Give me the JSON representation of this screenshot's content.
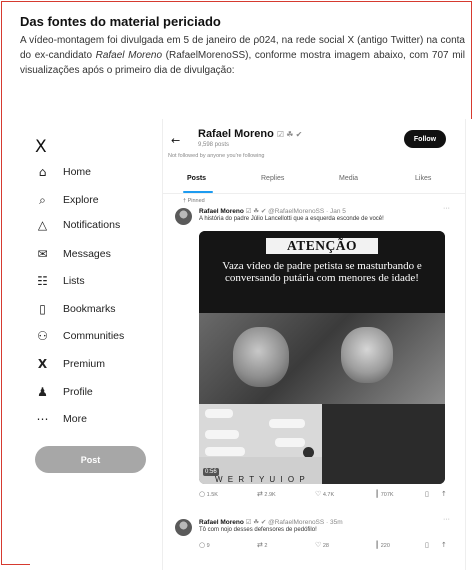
{
  "document": {
    "heading": "Das fontes do material periciado",
    "paragraph": {
      "part1": "A vídeo-montagem foi divulgada em 5 de janeiro de ρ024, na rede social X (antigo Twitter) na conta do ex-candidato ",
      "name_italic": "Rafael Moreno",
      "part2": " (RafaelMorenoSS), conforme mostra imagem abaixo, com 707 mil visualizações após o primeiro dia de divulgação:"
    }
  },
  "x_screenshot": {
    "sidebar": {
      "logo": "X",
      "items": [
        {
          "label": "Home",
          "icon": "home-icon",
          "glyph": "⌂"
        },
        {
          "label": "Explore",
          "icon": "search-icon",
          "glyph": "⌕"
        },
        {
          "label": "Notifications",
          "icon": "bell-icon",
          "glyph": "△"
        },
        {
          "label": "Messages",
          "icon": "envelope-icon",
          "glyph": "✉"
        },
        {
          "label": "Lists",
          "icon": "list-icon",
          "glyph": "☷"
        },
        {
          "label": "Bookmarks",
          "icon": "bookmark-icon",
          "glyph": "▯"
        },
        {
          "label": "Communities",
          "icon": "people-icon",
          "glyph": "⚇"
        },
        {
          "label": "Premium",
          "icon": "x-icon",
          "glyph": "X"
        },
        {
          "label": "Profile",
          "icon": "person-icon",
          "glyph": "♟"
        },
        {
          "label": "More",
          "icon": "more-icon",
          "glyph": "⋯"
        }
      ],
      "post_button": "Post"
    },
    "profile": {
      "back": "←",
      "name": "Rafael Moreno",
      "badges": "☑ ☘ ✔",
      "post_count": "9,598 posts",
      "follow": "Follow",
      "not_followed": "Not followed by anyone you're following",
      "tabs": [
        "Posts",
        "Replies",
        "Media",
        "Likes"
      ]
    },
    "pinned_label": "† Pinned",
    "tweet1": {
      "name": "Rafael Moreno",
      "meta": "☑ ☘ ✔ @RafaelMorenoSS · Jan 5",
      "text": "A história do padre Júlio Lancellotti que a esquerda esconde de você!",
      "media_title": "ATENÇÃO",
      "media_headline": "Vaza vídeo de padre petista se masturbando e conversando putária com menores de idade!",
      "video_time": "0:56",
      "keyboard": "W E R T Y U I O P",
      "replies": "1.5K",
      "reposts": "2.9K",
      "likes": "4.7K",
      "views": "707K"
    },
    "tweet2": {
      "name": "Rafael Moreno",
      "meta": "☑ ☘ ✔ @RafaelMorenoSS · 35m",
      "text": "Tô com nojo desses defensores de pedófilo!",
      "replies": "9",
      "reposts": "2",
      "likes": "28",
      "views": "220"
    },
    "icons": {
      "reply": "○",
      "repost": "⇄",
      "like": "♡",
      "views": "┃",
      "bookmark": "▯",
      "share": "↑",
      "more": "···"
    }
  }
}
